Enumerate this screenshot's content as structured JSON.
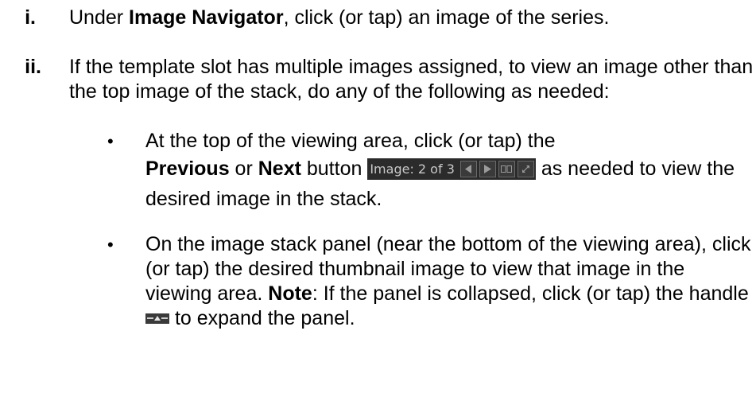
{
  "steps": [
    {
      "marker": "i.",
      "pre": "Under ",
      "bold": "Image Navigator",
      "post": ", click (or tap) an image of the series."
    },
    {
      "marker": "ii.",
      "text": "If the template slot has multiple images assigned, to view an image other than the top image of the stack, do any of the following as needed:"
    }
  ],
  "bullets": [
    {
      "pre": "At the top of the viewing area, click (or tap) the ",
      "bold_previous": "Previous",
      "or": " or ",
      "bold_next": "Next",
      "button_word": " button ",
      "post": " as needed to view the desired image in the stack."
    },
    {
      "text": "On the image stack panel (near the bottom of the viewing area), click (or tap) the desired thumbnail image to view that image in the viewing area.",
      "note_label": "Note",
      "note_pre": ": If the panel is collapsed, click (or tap) the handle ",
      "note_post": " to expand the panel."
    }
  ],
  "toolbar": {
    "label": "Image: 2 of 3",
    "icons": [
      "previous-icon",
      "next-icon",
      "layout-icon",
      "expand-icon"
    ],
    "background": "#2b2b2b"
  },
  "handle_icon": "expand-handle-icon"
}
